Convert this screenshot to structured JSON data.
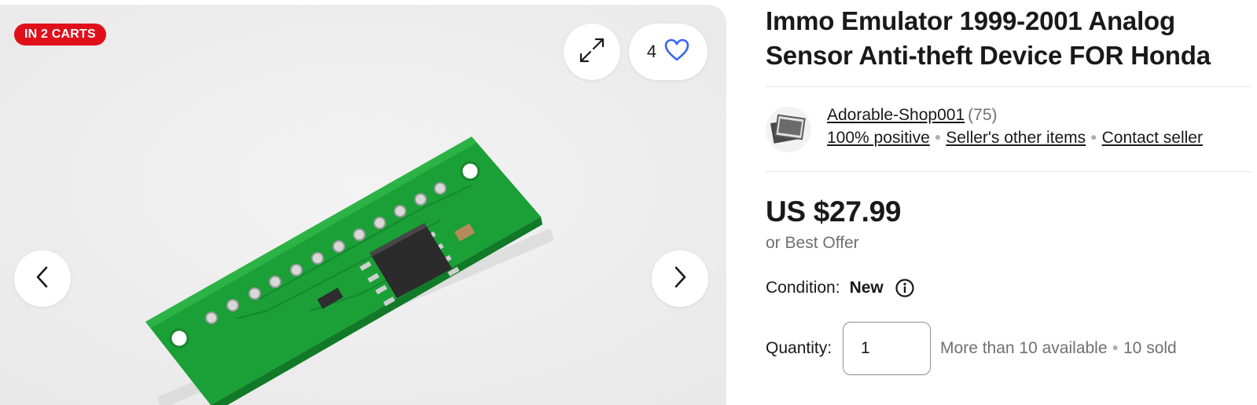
{
  "gallery": {
    "badge": "IN 2 CARTS",
    "watch_count": "4",
    "icons": {
      "expand": "expand-arrows-icon",
      "watch": "heart-icon",
      "prev": "chevron-left-icon",
      "next": "chevron-right-icon"
    },
    "photo": "green-pcb-with-chip"
  },
  "listing": {
    "title": "Immo Emulator 1999-2001 Analog Sensor Anti-theft Device FOR Honda",
    "seller": {
      "name": "Adorable-Shop001",
      "feedback_count": "(75)",
      "positive": "100% positive",
      "other_items": "Seller's other items",
      "contact": "Contact seller",
      "avatar_icon": "store-photo-icon"
    },
    "price": "US $27.99",
    "best_offer": "or Best Offer",
    "condition": {
      "label": "Condition:",
      "value": "New",
      "icon": "info-icon"
    },
    "quantity": {
      "label": "Quantity:",
      "value": "1",
      "available": "More than 10 available",
      "sold": "10 sold"
    }
  },
  "colors": {
    "badge_bg": "#e0101b",
    "heart": "#3665f3",
    "text_primary": "#191919",
    "text_secondary": "#707070",
    "pcb_green": "#1aa037"
  }
}
